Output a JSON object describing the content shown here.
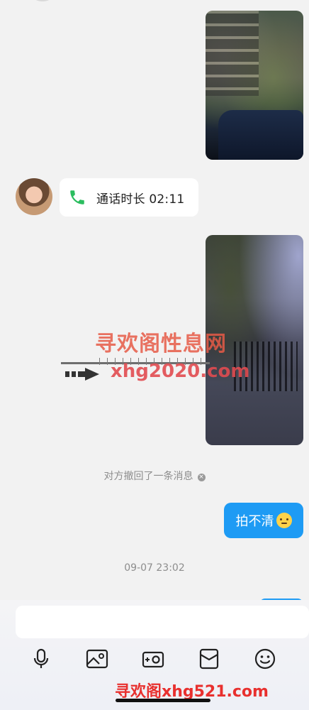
{
  "messages": {
    "call": {
      "text": "通话时长 02:11"
    },
    "recall_notice": "对方撤回了一条消息",
    "outgoing_text": "拍不清",
    "timestamp": "09-07 23:02"
  },
  "watermark": {
    "title": "寻欢阁性息网",
    "domain": "xhg2020.com",
    "bottom": "寻欢阁xhg521.com"
  },
  "composer": {
    "input_value": "",
    "tools": [
      "mic-icon",
      "image-icon",
      "camera-icon",
      "red-packet-icon",
      "emoji-icon"
    ]
  },
  "colors": {
    "background": "#f2f2f2",
    "outgoing_bubble": "#1e9bf4",
    "call_icon": "#2bbd5f",
    "watermark_red": "#e8302e"
  }
}
